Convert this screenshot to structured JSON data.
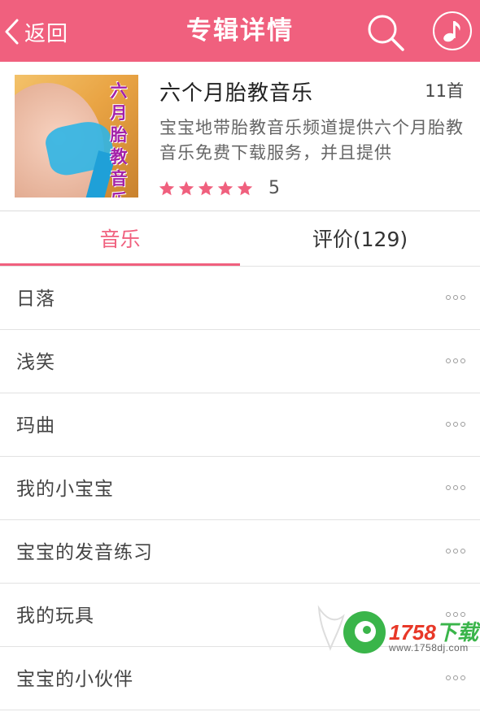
{
  "header": {
    "back_label": "返回",
    "title": "专辑详情",
    "accent_color": "#f0607e"
  },
  "album": {
    "name": "六个月胎教音乐",
    "track_count": "11首",
    "description": "宝宝地带胎教音乐频道提供六个月胎教音乐免费下载服务，并且提供",
    "cover_text": "六月胎教音乐",
    "stars": 5,
    "rating": "5",
    "star_color": "#f0607e"
  },
  "tabs": [
    {
      "label": "音乐",
      "active": true
    },
    {
      "label": "评价(129)",
      "active": false
    }
  ],
  "tracks": [
    {
      "name": "日落"
    },
    {
      "name": "浅笑"
    },
    {
      "name": "玛曲"
    },
    {
      "name": "我的小宝宝"
    },
    {
      "name": "宝宝的发音练习"
    },
    {
      "name": "我的玩具"
    },
    {
      "name": "宝宝的小伙伴"
    }
  ],
  "icons": {
    "back": "chevron-left-icon",
    "search": "search-icon",
    "music": "music-note-icon",
    "more": "more-dots-icon"
  },
  "watermark": {
    "brand_number": "1758",
    "brand_text": "下载",
    "url": "www.1758dj.com"
  }
}
